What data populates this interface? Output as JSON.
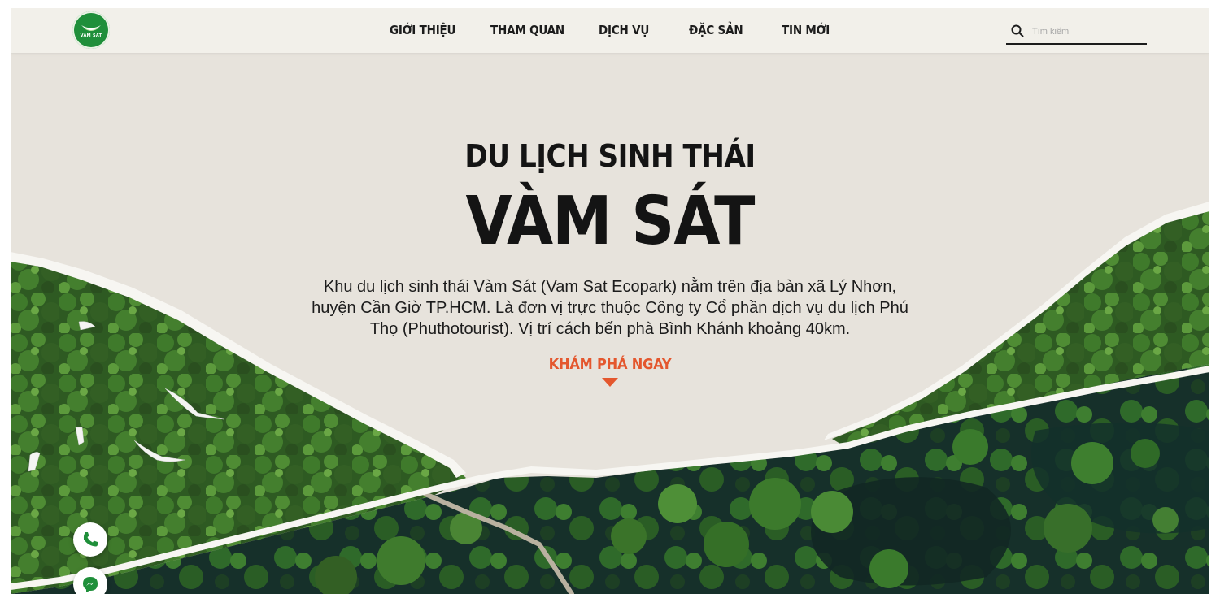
{
  "header": {
    "logo": {
      "text": "VÀM SÁT",
      "icon": "leaf-boat-logo-icon"
    },
    "nav": [
      {
        "label": "GIỚI THIỆU"
      },
      {
        "label": "THAM QUAN"
      },
      {
        "label": "DỊCH VỤ"
      },
      {
        "label": "ĐẶC SẢN"
      },
      {
        "label": "TIN MỚI"
      }
    ],
    "search": {
      "placeholder": "Tìm kiếm",
      "value": "",
      "icon": "search-icon"
    }
  },
  "hero": {
    "subtitle": "DU LỊCH SINH THÁI",
    "title": "VÀM SÁT",
    "description": "Khu du lịch sinh thái Vàm Sát (Vam Sat Ecopark) nằm trên địa bàn xã Lý Nhơn, huyện Cần Giờ TP.HCM. Là đơn vị trực thuộc Công ty Cổ phần dịch vụ du lịch Phú Thọ (Phuthotourist). Vị trí cách bến phà Bình Khánh khoảng 40km.",
    "cta": {
      "label": "KHÁM PHÁ NGAY",
      "icon": "triangle-down-icon"
    }
  },
  "floating": {
    "phone": {
      "icon": "phone-icon"
    },
    "messenger": {
      "icon": "messenger-icon"
    }
  },
  "colors": {
    "accent": "#e4572e",
    "background": "#e7e3dc",
    "header": "#f2f0ea",
    "forest_dark": "#1f3a1c",
    "forest": "#2f5a25",
    "water": "#15302c",
    "logo_green": "#1f8f3a"
  }
}
